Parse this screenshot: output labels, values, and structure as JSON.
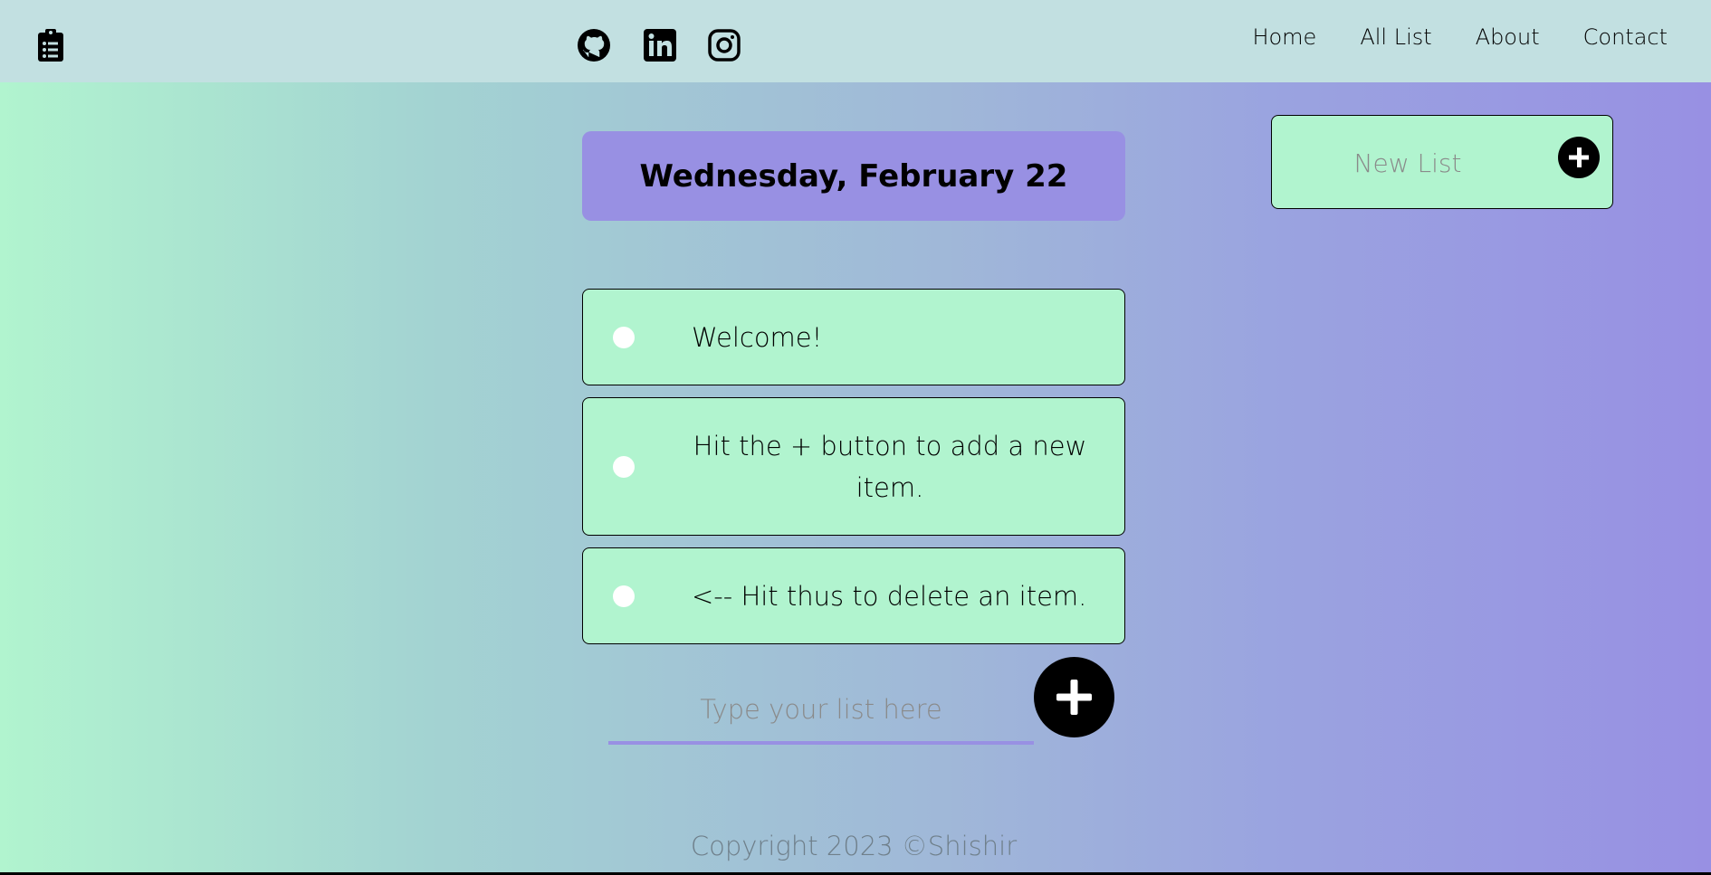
{
  "header": {
    "logo_icon": "clipboard-list-icon",
    "social": [
      {
        "name": "github-icon"
      },
      {
        "name": "linkedin-icon"
      },
      {
        "name": "instagram-icon"
      }
    ],
    "nav": [
      "Home",
      "All List",
      "About",
      "Contact"
    ]
  },
  "main": {
    "date": "Wednesday, February 22",
    "items": [
      {
        "text": "Welcome!",
        "checked": false
      },
      {
        "text": "Hit the + button to add a new item.",
        "checked": false
      },
      {
        "text": "<-- Hit thus to delete an item.",
        "checked": false
      }
    ],
    "new_item_placeholder": "Type your list here",
    "add_icon": "plus-icon"
  },
  "sidebar": {
    "new_list_placeholder": "New List",
    "add_icon": "plus-icon"
  },
  "footer": {
    "copyright": "Copyright 2023 ©Shishir"
  },
  "colors": {
    "accent": "#9890e3",
    "mint": "#b1f4cf",
    "topbar": "#c2e0e1"
  }
}
